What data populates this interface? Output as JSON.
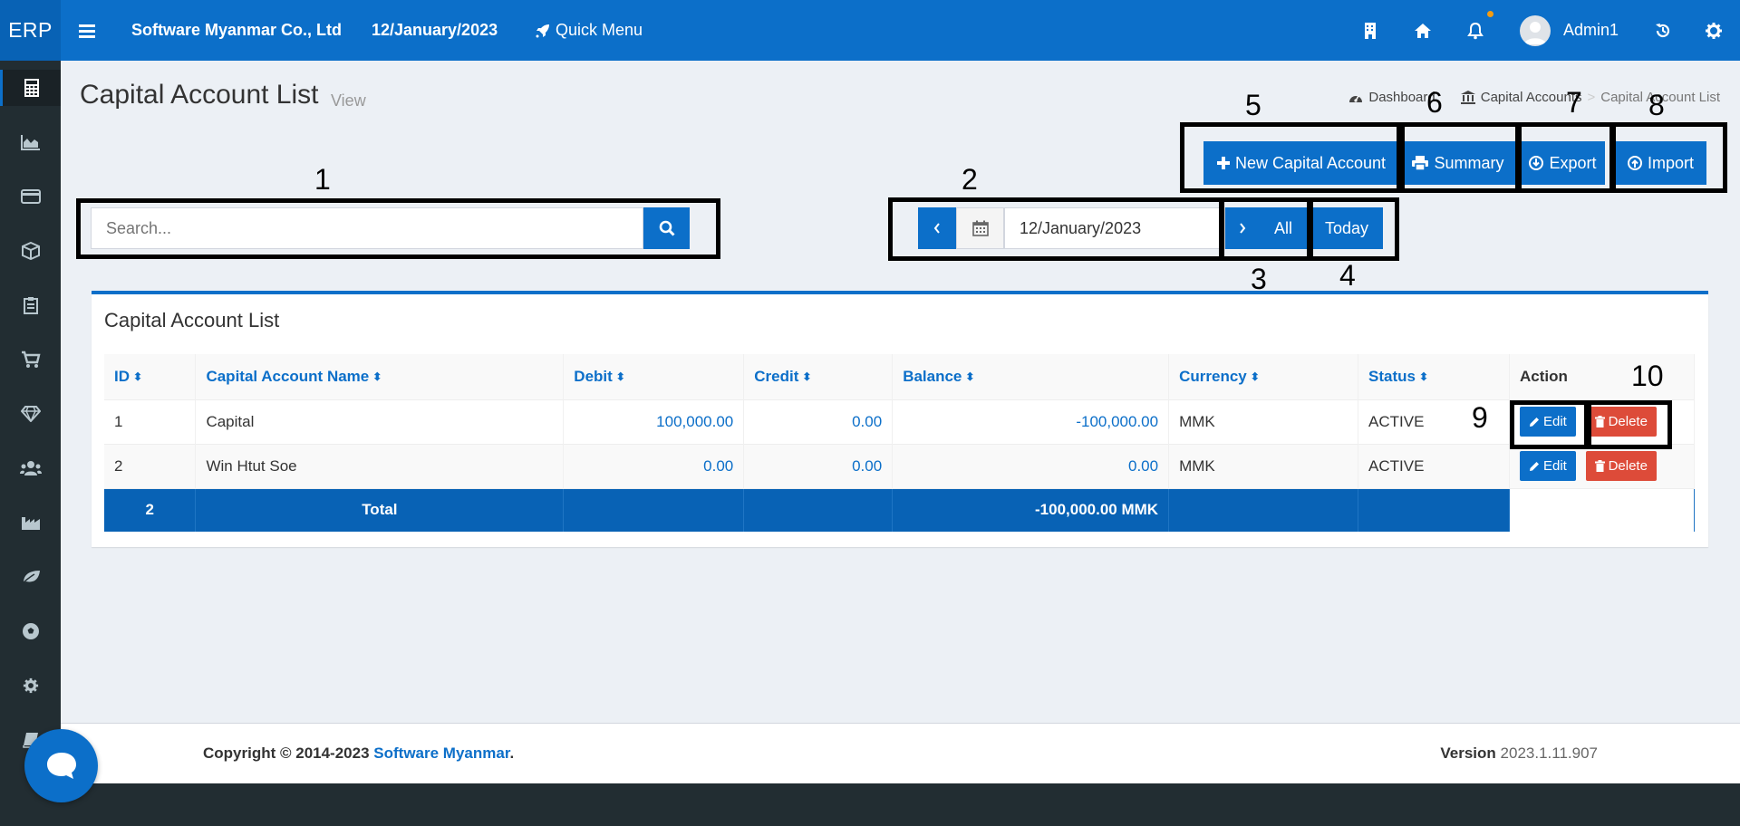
{
  "header": {
    "brand": "ERP",
    "company": "Software Myanmar Co., Ltd",
    "date": "12/January/2023",
    "quick_menu": "Quick Menu",
    "user_name": "Admin1"
  },
  "page": {
    "title": "Capital Account List",
    "subtitle": "View"
  },
  "breadcrumb": {
    "items": [
      "Dashboard",
      "Capital Accounts",
      "Capital Account List"
    ],
    "separator": ">"
  },
  "toolbar": {
    "new_label": "New Capital Account",
    "summary_label": "Summary",
    "export_label": "Export",
    "import_label": "Import"
  },
  "search": {
    "placeholder": "Search..."
  },
  "date_filter": {
    "value": "12/January/2023",
    "all_label": "All",
    "today_label": "Today"
  },
  "table": {
    "title": "Capital Account List",
    "columns": [
      "ID",
      "Capital Account Name",
      "Debit",
      "Credit",
      "Balance",
      "Currency",
      "Status",
      "Action"
    ],
    "rows": [
      {
        "id": "1",
        "name": "Capital",
        "debit": "100,000.00",
        "credit": "0.00",
        "balance": "-100,000.00",
        "currency": "MMK",
        "status": "ACTIVE"
      },
      {
        "id": "2",
        "name": "Win Htut Soe",
        "debit": "0.00",
        "credit": "0.00",
        "balance": "0.00",
        "currency": "MMK",
        "status": "ACTIVE"
      }
    ],
    "total": {
      "count": "2",
      "label": "Total",
      "balance": "-100,000.00 MMK"
    },
    "edit_label": "Edit",
    "delete_label": "Delete"
  },
  "annotations": [
    "1",
    "2",
    "3",
    "4",
    "5",
    "6",
    "7",
    "8",
    "9",
    "10"
  ],
  "footer": {
    "copyright": "Copyright © 2014-2023",
    "company_link": "Software Myanmar",
    "period": ".",
    "version_label": "Version",
    "version_value": "2023.1.11.907"
  },
  "colors": {
    "primary": "#0c6fc9",
    "danger": "#dd4b39",
    "sidebar": "#222d32",
    "notification_dot": "#f39c12"
  }
}
